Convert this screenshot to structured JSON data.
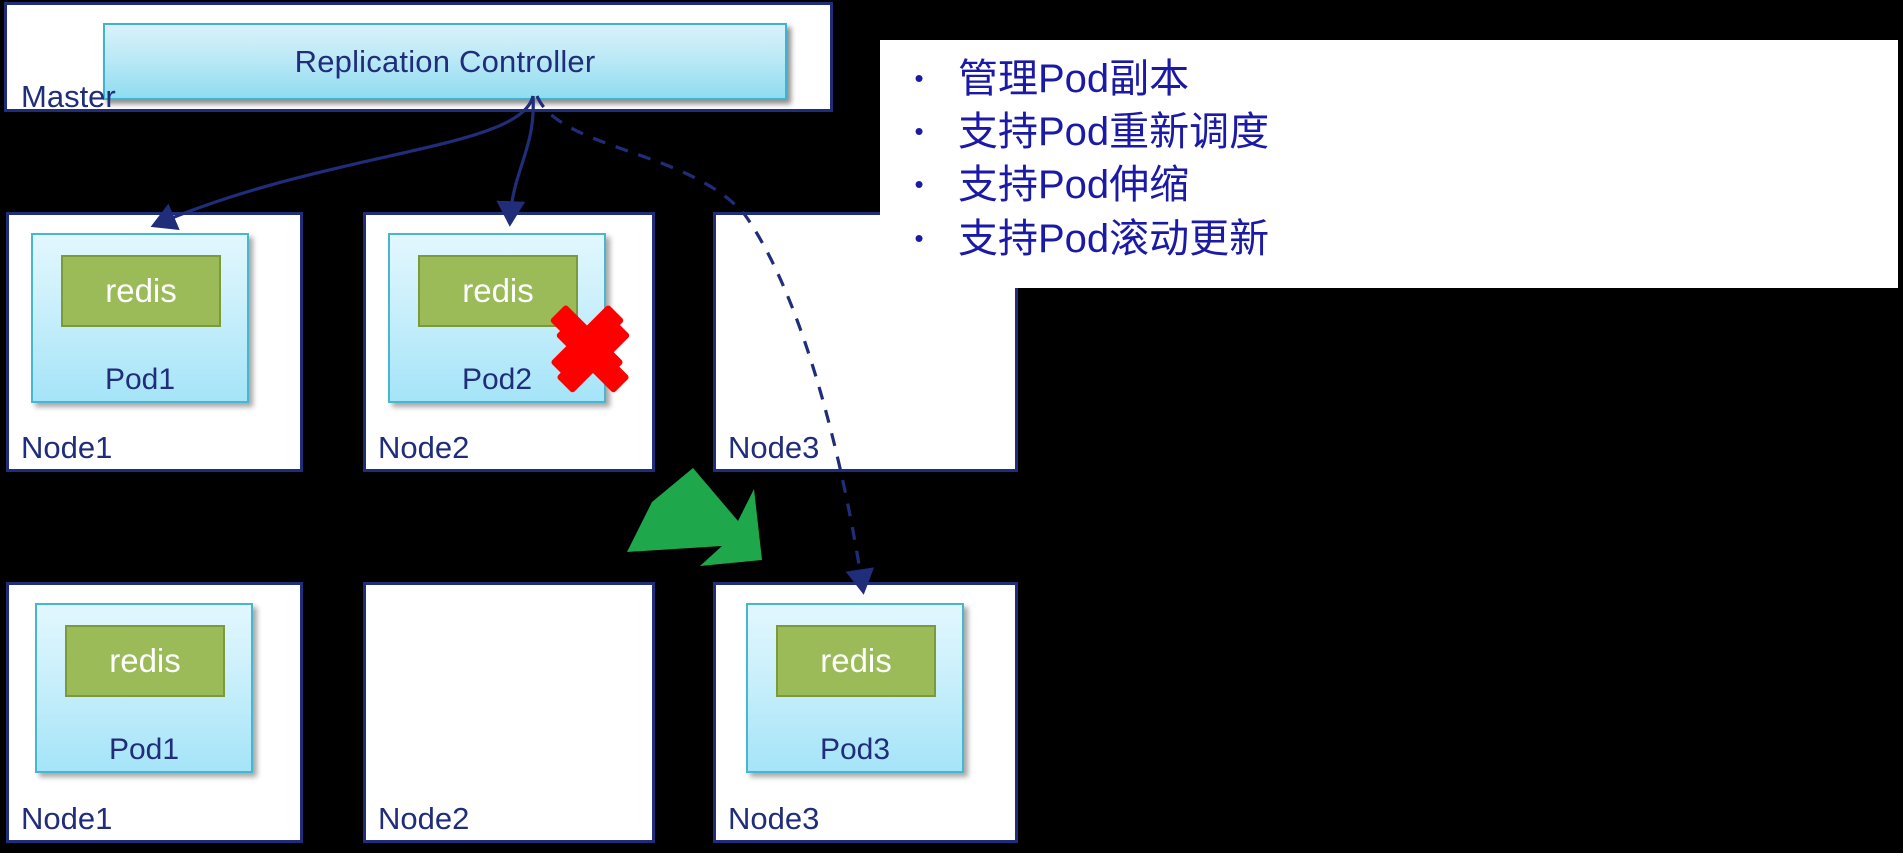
{
  "diagram": {
    "title": "Kubernetes Replication Controller Pod rescheduling",
    "master": {
      "label": "Master",
      "controller_label": "Replication Controller"
    },
    "rows": [
      {
        "row_id": "before",
        "nodes": [
          {
            "node_label": "Node1",
            "pod": {
              "pod_label": "Pod1",
              "container_label": "redis"
            },
            "failed": false
          },
          {
            "node_label": "Node2",
            "pod": {
              "pod_label": "Pod2",
              "container_label": "redis"
            },
            "failed": true
          },
          {
            "node_label": "Node3",
            "pod": null,
            "failed": false
          }
        ]
      },
      {
        "row_id": "after",
        "nodes": [
          {
            "node_label": "Node1",
            "pod": {
              "pod_label": "Pod1",
              "container_label": "redis"
            },
            "failed": false
          },
          {
            "node_label": "Node2",
            "pod": null,
            "failed": false
          },
          {
            "node_label": "Node3",
            "pod": {
              "pod_label": "Pod3",
              "container_label": "redis"
            },
            "failed": false
          }
        ]
      }
    ],
    "markers": {
      "failure_mark": "red-x-mark",
      "transition_arrow": "green-down-arrow"
    },
    "edges": [
      {
        "from": "Replication Controller",
        "to": "Pod1",
        "style": "solid"
      },
      {
        "from": "Replication Controller",
        "to": "Pod2",
        "style": "solid"
      },
      {
        "from": "Replication Controller",
        "to": "Pod3",
        "style": "dashed"
      }
    ]
  },
  "notes": {
    "bullet_glyph": "•",
    "items": [
      "管理Pod副本",
      "支持Pod重新调度",
      "支持Pod伸缩",
      "支持Pod滚动更新"
    ]
  },
  "colors": {
    "background": "#000000",
    "panel": "#ffffff",
    "border_blue": "#1F2D7A",
    "text_blue": "#1F2D7A",
    "notes_text": "#1A1AA6",
    "pod_fill": "#A5E4F8",
    "pod_border": "#45B7D1",
    "container_fill": "#9BBB59",
    "container_border": "#7C9A3C",
    "failure_red": "#FF0000",
    "transition_green": "#1EA84B",
    "controller_fill": "#8FDCF0"
  }
}
